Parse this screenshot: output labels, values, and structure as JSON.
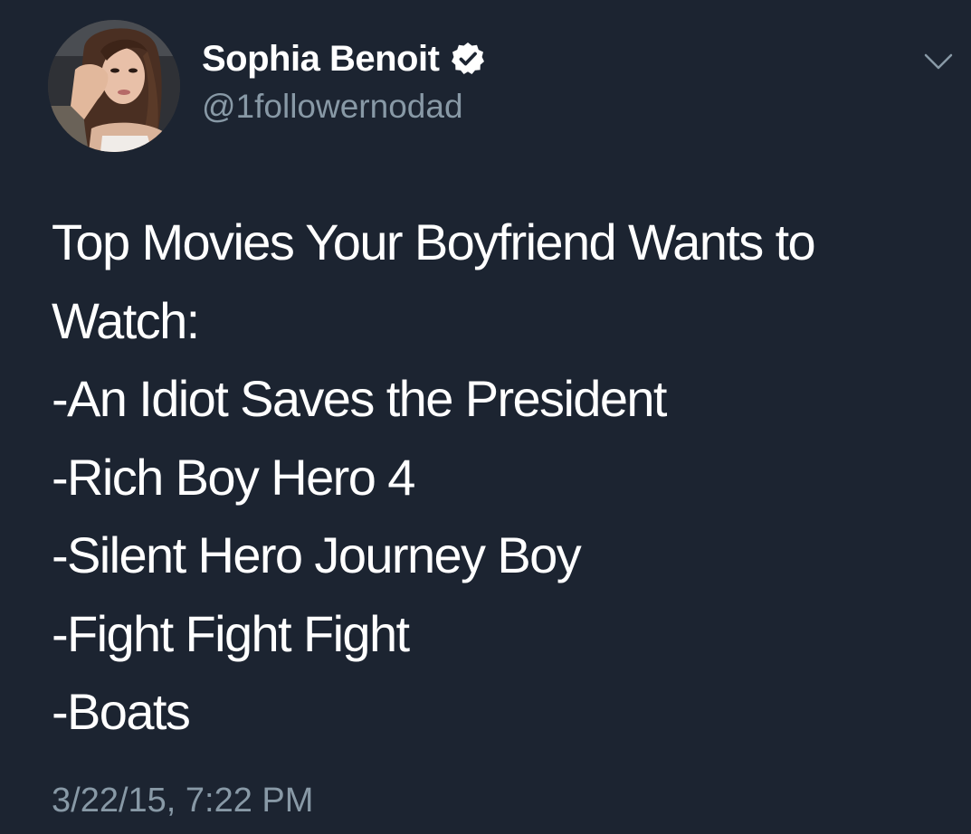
{
  "tweet": {
    "author": {
      "display_name": "Sophia Benoit",
      "handle": "@1followernodad",
      "verified": true,
      "verified_icon": "verified-badge-icon",
      "avatar": "profile-photo"
    },
    "menu_icon": "chevron-down-icon",
    "text_lines": [
      "Top Movies Your Boyfriend Wants to",
      "Watch:",
      "-An Idiot Saves the President",
      "-Rich Boy Hero 4",
      "-Silent Hero Journey Boy",
      "-Fight Fight Fight",
      "-Boats"
    ],
    "timestamp": "3/22/15, 7:22 PM"
  },
  "colors": {
    "background": "#1c2431",
    "primary_text": "#ffffff",
    "secondary_text": "#8899a6"
  }
}
